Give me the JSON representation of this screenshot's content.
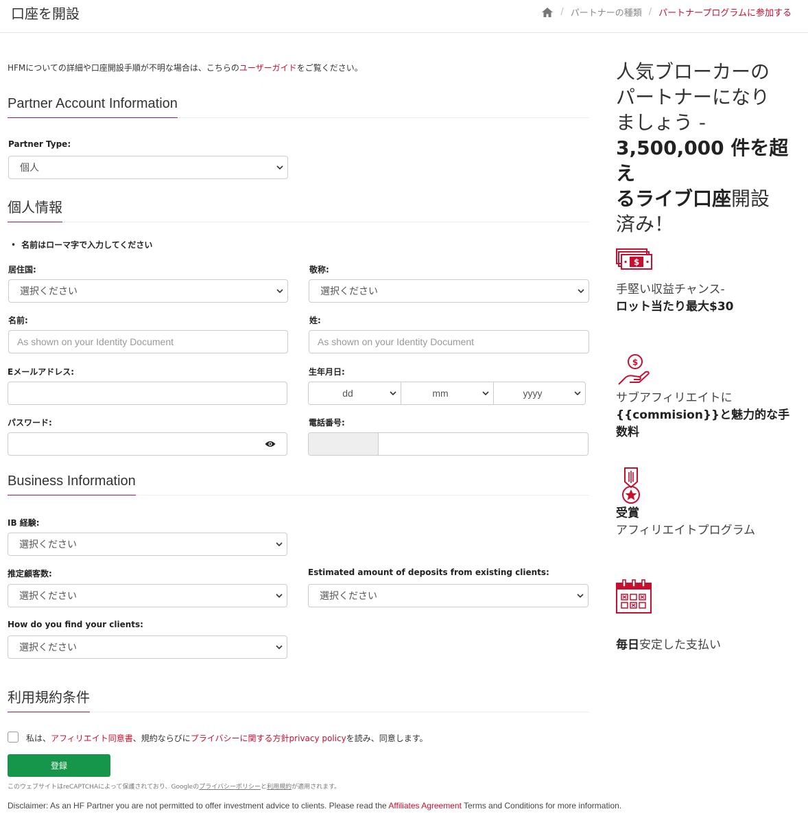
{
  "header": {
    "title": "口座を開設",
    "breadcrumb": [
      "パートナーの種類",
      "パートナープログラムに参加する"
    ]
  },
  "intro": {
    "before": "HFMについての詳細や口座開設手順が不明な場合は、こちらの",
    "link": "ユーザーガイド",
    "after": "をご覧ください。"
  },
  "sections": {
    "partner": "Partner Account Information",
    "personal": "個人情報",
    "business": "Business Information",
    "terms": "利用規約条件"
  },
  "partner_type": {
    "label": "Partner Type:",
    "value": "個人"
  },
  "personal": {
    "note": "名前はローマ字で入力してください",
    "country_label": "居住国:",
    "country_value": "選択ください",
    "title_label": "敬称:",
    "title_value": "選択ください",
    "first_label": "名前:",
    "first_placeholder": "As shown on your Identity Document",
    "last_label": "姓:",
    "last_placeholder": "As shown on your Identity Document",
    "email_label": "Eメールアドレス:",
    "dob_label": "生年月日:",
    "dob_day": "dd",
    "dob_month": "mm",
    "dob_year": "yyyy",
    "password_label": "パスワード:",
    "phone_label": "電話番号:"
  },
  "business": {
    "ib_label": "IB 経験:",
    "ib_value": "選択ください",
    "clients_label": "推定顧客数:",
    "clients_value": "選択ください",
    "deposits_label": "Estimated amount of deposits from existing clients:",
    "deposits_value": "選択ください",
    "find_label": "How do you find your clients:",
    "find_value": "選択ください"
  },
  "terms": {
    "p1": "私は、",
    "link1": "アフィリエイト同意書",
    "p2": "、規約ならびに",
    "link2": "プライバシーに関する方針privacy policy",
    "p3": "を読み、同意します。",
    "submit": "登録",
    "recaptcha_a": "このウェブサイトはreCAPTCHAによって保護されており、Googleの",
    "recaptcha_link1": "プライバシーポリシー",
    "recaptcha_b": "と",
    "recaptcha_link2": "利用規約",
    "recaptcha_c": "が適用されます。",
    "disclaimer_a": "Disclaimer: As an HF Partner you are not permitted to offer investment advice to clients. Please read the ",
    "disclaimer_link": "Affiliates Agreement",
    "disclaimer_b": " Terms and Conditions for more information."
  },
  "aside": {
    "headline_l1": "人気ブローカーの",
    "headline_l2": "パートナーになり",
    "headline_l3": "ましょう -",
    "headline_b1": "3,500,000 件を超え",
    "headline_b2": "るライブ口座",
    "headline_l4": "開設",
    "headline_l5": "済み！",
    "f1_line1": "手堅い収益チャンス-",
    "f1_line2": "ロット当たり最大$30",
    "f2_line1": "サブアフィリエイトに",
    "f2_line2": "{{commision}}と魅力的な手数料",
    "f3_line1": "受賞",
    "f3_line2": "アフィリエイトプログラム",
    "f4_bold": "毎日",
    "f4_text": "安定した支払い"
  },
  "colors": {
    "brand_red": "#c8102e",
    "submit_green": "#16964a"
  },
  "icons": [
    "home-icon",
    "money-icon",
    "hand-coin-icon",
    "award-medal-icon",
    "calendar-icon",
    "eye-icon"
  ]
}
